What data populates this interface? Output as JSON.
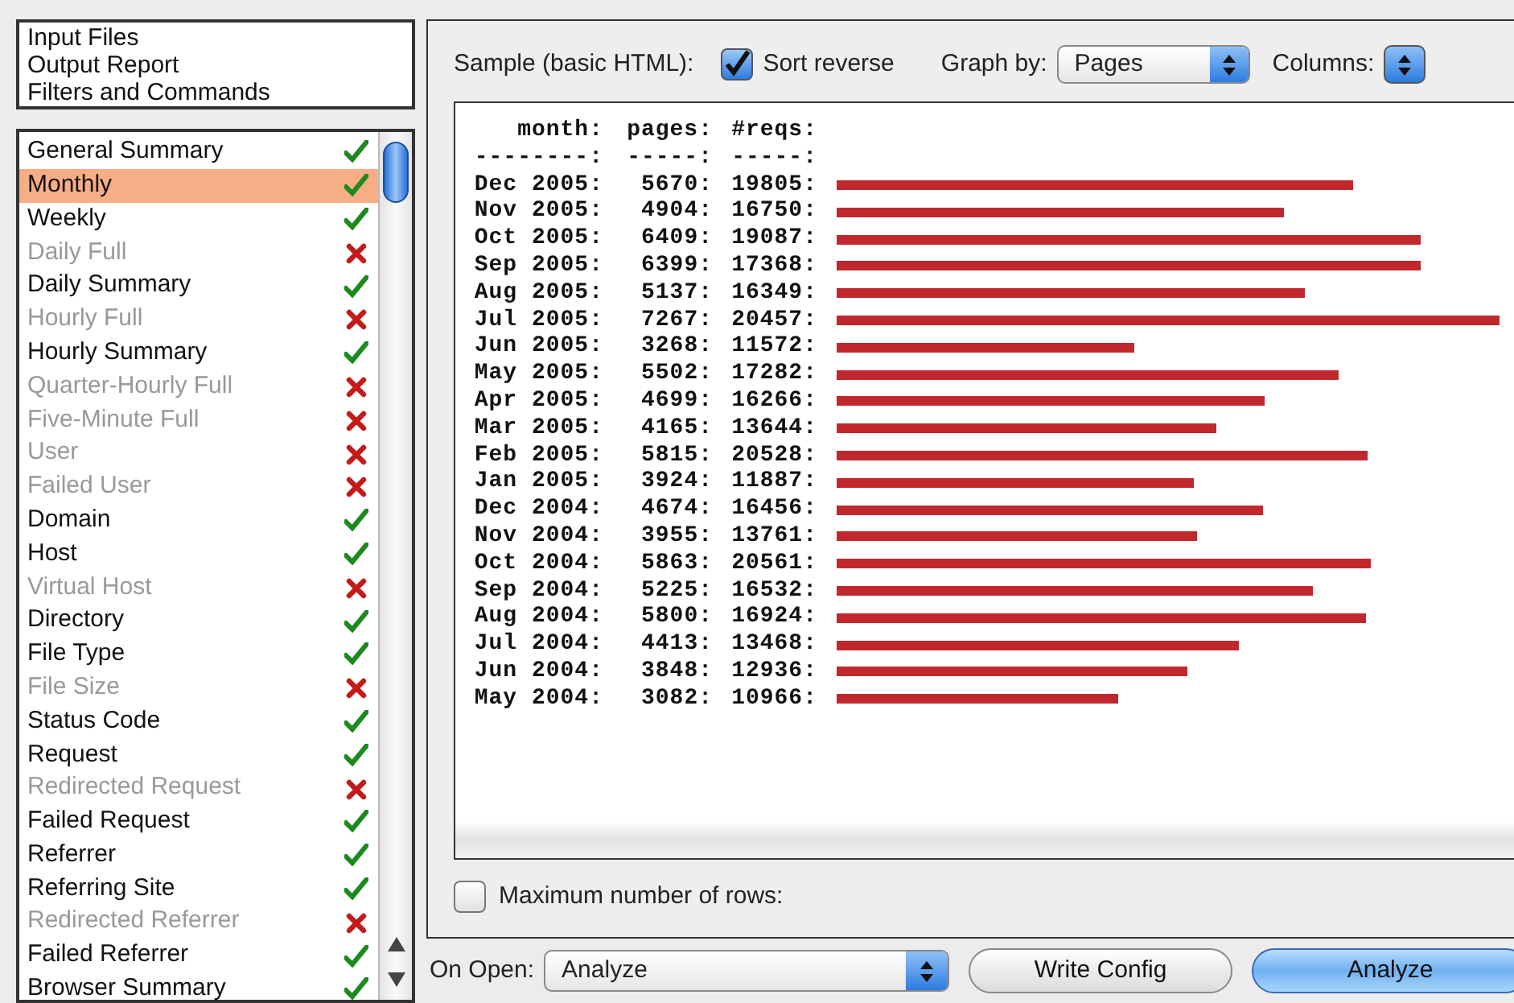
{
  "sections": [
    {
      "label": "Input Files"
    },
    {
      "label": "Output Report"
    },
    {
      "label": "Filters and Commands"
    }
  ],
  "reports": [
    {
      "label": "General Summary",
      "enabled": true,
      "selected": false
    },
    {
      "label": "Monthly",
      "enabled": true,
      "selected": true
    },
    {
      "label": "Weekly",
      "enabled": true,
      "selected": false
    },
    {
      "label": "Daily Full",
      "enabled": false,
      "selected": false
    },
    {
      "label": "Daily Summary",
      "enabled": true,
      "selected": false
    },
    {
      "label": "Hourly Full",
      "enabled": false,
      "selected": false
    },
    {
      "label": "Hourly Summary",
      "enabled": true,
      "selected": false
    },
    {
      "label": "Quarter-Hourly Full",
      "enabled": false,
      "selected": false
    },
    {
      "label": "Five-Minute Full",
      "enabled": false,
      "selected": false
    },
    {
      "label": "User",
      "enabled": false,
      "selected": false
    },
    {
      "label": "Failed User",
      "enabled": false,
      "selected": false
    },
    {
      "label": "Domain",
      "enabled": true,
      "selected": false
    },
    {
      "label": "Host",
      "enabled": true,
      "selected": false
    },
    {
      "label": "Virtual Host",
      "enabled": false,
      "selected": false
    },
    {
      "label": "Directory",
      "enabled": true,
      "selected": false
    },
    {
      "label": "File Type",
      "enabled": true,
      "selected": false
    },
    {
      "label": "File Size",
      "enabled": false,
      "selected": false
    },
    {
      "label": "Status Code",
      "enabled": true,
      "selected": false
    },
    {
      "label": "Request",
      "enabled": true,
      "selected": false
    },
    {
      "label": "Redirected Request",
      "enabled": false,
      "selected": false
    },
    {
      "label": "Failed Request",
      "enabled": true,
      "selected": false
    },
    {
      "label": "Referrer",
      "enabled": true,
      "selected": false
    },
    {
      "label": "Referring Site",
      "enabled": true,
      "selected": false
    },
    {
      "label": "Redirected Referrer",
      "enabled": false,
      "selected": false
    },
    {
      "label": "Failed Referrer",
      "enabled": true,
      "selected": false
    },
    {
      "label": "Browser Summary",
      "enabled": true,
      "selected": false
    }
  ],
  "options": {
    "sample_label": "Sample (basic HTML):",
    "sort_reverse": {
      "label": "Sort reverse",
      "checked": true
    },
    "graph_by": {
      "label": "Graph by:",
      "value": "Pages"
    },
    "columns": {
      "label": "Columns:"
    }
  },
  "sample": {
    "header": [
      "month:",
      "pages:",
      "#reqs:"
    ],
    "rule": [
      "--------:",
      "-----:",
      "-----:"
    ],
    "rows": [
      {
        "month": "Dec 2005:",
        "pages": "5670:",
        "reqs": "19805:"
      },
      {
        "month": "Nov 2005:",
        "pages": "4904:",
        "reqs": "16750:"
      },
      {
        "month": "Oct 2005:",
        "pages": "6409:",
        "reqs": "19087:"
      },
      {
        "month": "Sep 2005:",
        "pages": "6399:",
        "reqs": "17368:"
      },
      {
        "month": "Aug 2005:",
        "pages": "5137:",
        "reqs": "16349:"
      },
      {
        "month": "Jul 2005:",
        "pages": "7267:",
        "reqs": "20457:"
      },
      {
        "month": "Jun 2005:",
        "pages": "3268:",
        "reqs": "11572:"
      },
      {
        "month": "May 2005:",
        "pages": "5502:",
        "reqs": "17282:"
      },
      {
        "month": "Apr 2005:",
        "pages": "4699:",
        "reqs": "16266:"
      },
      {
        "month": "Mar 2005:",
        "pages": "4165:",
        "reqs": "13644:"
      },
      {
        "month": "Feb 2005:",
        "pages": "5815:",
        "reqs": "20528:"
      },
      {
        "month": "Jan 2005:",
        "pages": "3924:",
        "reqs": "11887:"
      },
      {
        "month": "Dec 2004:",
        "pages": "4674:",
        "reqs": "16456:"
      },
      {
        "month": "Nov 2004:",
        "pages": "3955:",
        "reqs": "13761:"
      },
      {
        "month": "Oct 2004:",
        "pages": "5863:",
        "reqs": "20561:"
      },
      {
        "month": "Sep 2004:",
        "pages": "5225:",
        "reqs": "16532:"
      },
      {
        "month": "Aug 2004:",
        "pages": "5800:",
        "reqs": "16924:"
      },
      {
        "month": "Jul 2004:",
        "pages": "4413:",
        "reqs": "13468:"
      },
      {
        "month": "Jun 2004:",
        "pages": "3848:",
        "reqs": "12936:"
      },
      {
        "month": "May 2004:",
        "pages": "3082:",
        "reqs": "10966:"
      }
    ]
  },
  "max_rows": {
    "label": "Maximum number of rows:",
    "checked": false
  },
  "footer": {
    "on_open_label": "On Open:",
    "on_open_value": "Analyze",
    "buttons": [
      {
        "label": "Write Config",
        "default": false
      },
      {
        "label": "Analyze",
        "default": true
      }
    ]
  }
}
